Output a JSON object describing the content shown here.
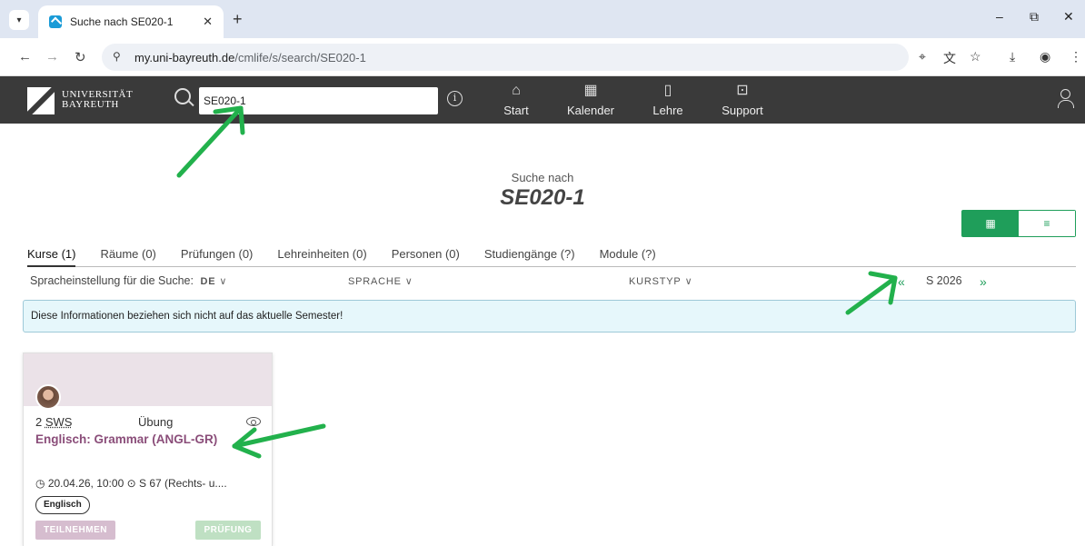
{
  "browser": {
    "tab_title": "Suche nach SE020-1",
    "url_host": "my.uni-bayreuth.de",
    "url_path": "/cmlife/s/search/SE020-1"
  },
  "header": {
    "logo_line1": "UNIVERSITÄT",
    "logo_line2": "BAYREUTH",
    "search_value": "SE020-1",
    "nav": [
      {
        "label": "Start",
        "icon": "home-icon"
      },
      {
        "label": "Kalender",
        "icon": "calendar-icon"
      },
      {
        "label": "Lehre",
        "icon": "book-icon"
      },
      {
        "label": "Support",
        "icon": "toolbox-icon"
      }
    ]
  },
  "main": {
    "search_label": "Suche nach",
    "search_term": "SE020-1",
    "tabs": [
      {
        "label": "Kurse (1)"
      },
      {
        "label": "Räume (0)"
      },
      {
        "label": "Prüfungen (0)"
      },
      {
        "label": "Lehreinheiten (0)"
      },
      {
        "label": "Personen (0)"
      },
      {
        "label": "Studiengänge (?)"
      },
      {
        "label": "Module (?)"
      }
    ],
    "filters": {
      "language_setting_label": "Spracheinstellung für die Suche:",
      "language_setting_value": "DE",
      "sprache": "SPRACHE",
      "kurstyp": "KURSTYP",
      "semester": "S 2026",
      "prev_symbol": "«",
      "next_symbol": "»"
    },
    "info_message": "Diese Informationen beziehen sich nicht auf das aktuelle Semester!",
    "course": {
      "sws_num": "2",
      "sws_unit": "SWS",
      "type": "Übung",
      "title": "Englisch: Grammar (ANGL-GR)",
      "meta_time": "20.04.26, 10:00",
      "meta_room": "S 67 (Rechts- u....",
      "language_badge": "Englisch",
      "join_label": "TEILNEHMEN",
      "exam_label": "PRÜFUNG"
    }
  },
  "colors": {
    "accent_green": "#1f9e5a",
    "header_bg": "#3a3a3a",
    "course_title": "#8a4d79",
    "annotation_arrow": "#22b14c"
  }
}
